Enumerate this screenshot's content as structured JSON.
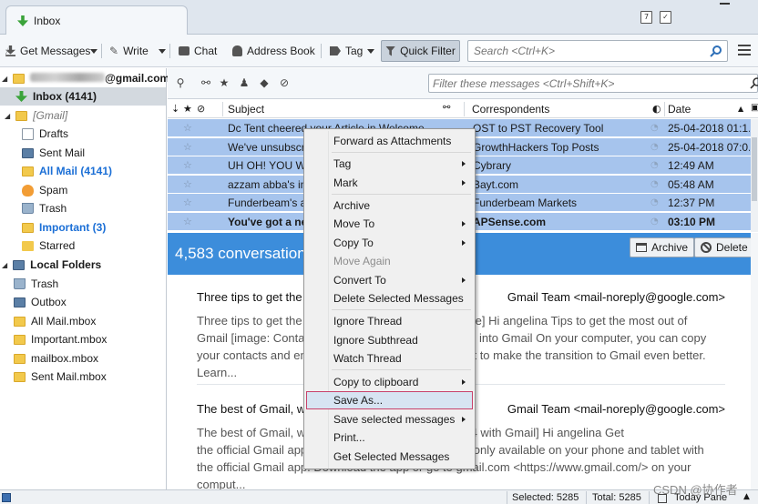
{
  "window": {
    "tab_title": "Inbox"
  },
  "toolbar": {
    "get_messages": "Get Messages",
    "write": "Write",
    "chat": "Chat",
    "address_book": "Address Book",
    "tag": "Tag",
    "quick_filter": "Quick Filter",
    "search_placeholder": "Search <Ctrl+K>"
  },
  "folders": {
    "account": "@gmail.com",
    "inbox": "Inbox (4141)",
    "gmail": "[Gmail]",
    "drafts": "Drafts",
    "sent_mail": "Sent Mail",
    "all_mail": "All Mail (4141)",
    "spam": "Spam",
    "trash": "Trash",
    "important": "Important (3)",
    "starred": "Starred",
    "local_folders": "Local Folders",
    "local_trash": "Trash",
    "outbox": "Outbox",
    "all_mail_mbox": "All Mail.mbox",
    "important_mbox": "Important.mbox",
    "mailbox_mbox": "mailbox.mbox",
    "sent_mail_mbox": "Sent Mail.mbox"
  },
  "filter": {
    "placeholder": "Filter these messages <Ctrl+Shift+K>"
  },
  "columns": {
    "subject": "Subject",
    "correspondents": "Correspondents",
    "date": "Date"
  },
  "messages": [
    {
      "subject": "Dc Tent cheered your Article in Welcome",
      "correspondent": "OST to PST Recovery Tool",
      "date": "25-04-2018 01:1..."
    },
    {
      "subject": "We've unsubscribed you",
      "correspondent": "GrowthHackers Top Posts",
      "date": "25-04-2018 07:0..."
    },
    {
      "subject": "UH OH! YOU WON",
      "correspondent": "Cybrary",
      "date": "12:49 AM"
    },
    {
      "subject": "azzam abba's invitation",
      "correspondent": "Bayt.com",
      "date": "05:48 AM"
    },
    {
      "subject": "Funderbeam's analysis",
      "correspondent": "Funderbeam Markets",
      "date": "12:37 PM"
    },
    {
      "subject": "You've got a new message",
      "correspondent": "APSense.com",
      "date": "03:10 PM"
    }
  ],
  "preview": {
    "count": "4,583 conversations",
    "archive": "Archive",
    "delete": "Delete",
    "messages": [
      {
        "subject": "Three tips to get the most out of Gmail",
        "from": "Gmail Team <mail-noreply@google.com>",
        "body_1": "Three tips to get the most out of Gmail [image: Google] Hi angelina Tips to get the most out of",
        "body_2": "Gmail [image: Contacts] Bring your contacts and mail into Gmail On your computer, you can copy",
        "body_3": "your contacts and emails from your old email account to make the transition to Gmail even better.",
        "body_4": "Learn..."
      },
      {
        "subject": "The best of Gmail, wherever you are",
        "from": "Gmail Team <mail-noreply@google.com>",
        "body_1": "The best of Gmail, wherever you are [image: Nexus 4 with Gmail] Hi angelina Get",
        "body_2": "the official Gmail app The best features of Gmail are only available on your phone and tablet with",
        "body_3": "the official Gmail app. Download the app or go to gmail.com <https://www.gmail.com/> on your",
        "body_4": "comput..."
      }
    ]
  },
  "context_menu": {
    "forward_as_attachments": "Forward as Attachments",
    "tag": "Tag",
    "mark": "Mark",
    "archive": "Archive",
    "move_to": "Move To",
    "copy_to": "Copy To",
    "move_again": "Move Again",
    "convert_to": "Convert To",
    "delete_selected": "Delete Selected Messages",
    "ignore_thread": "Ignore Thread",
    "ignore_subthread": "Ignore Subthread",
    "watch_thread": "Watch Thread",
    "copy_to_clipboard": "Copy to clipboard",
    "save_as": "Save As...",
    "save_selected": "Save selected messages",
    "print": "Print...",
    "get_selected": "Get Selected Messages"
  },
  "status": {
    "selected": "Selected: 5285",
    "total": "Total: 5285",
    "today_pane": "Today Pane"
  },
  "watermark": "CSDN @协作者",
  "colors": {
    "selection": "#a6c4ed",
    "banner": "#3c8ddb",
    "link_blue": "#1b6fd6",
    "menu_highlight_border": "#c8416a"
  }
}
